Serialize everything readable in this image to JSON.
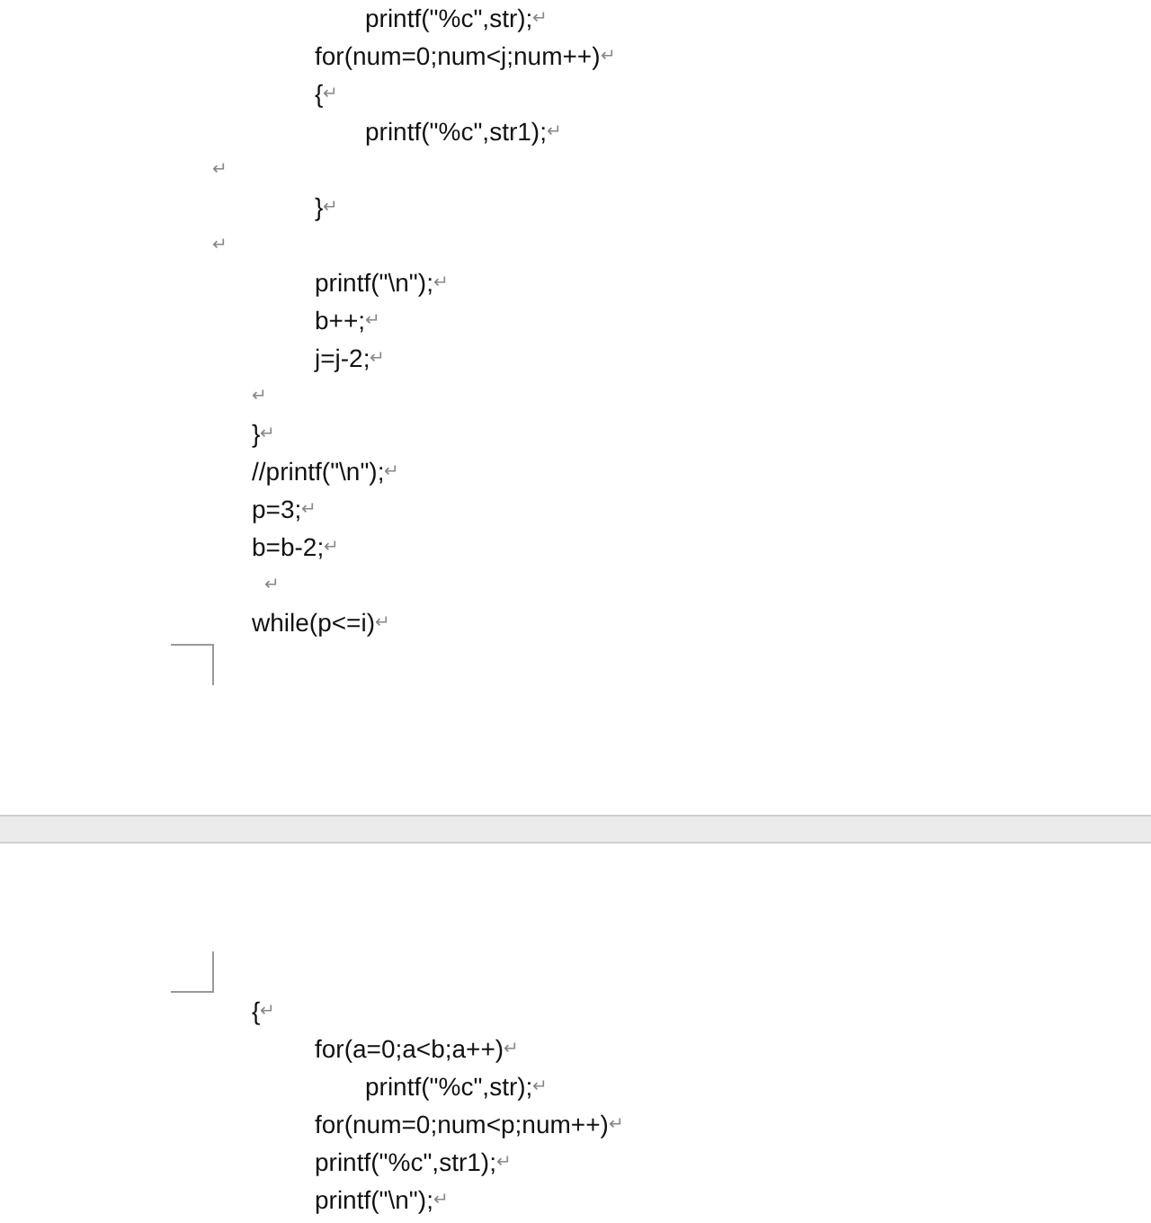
{
  "pages": [
    {
      "lines": [
        {
          "kind": "inner",
          "text": "printf(\"%c\",str);",
          "mark": "↵"
        },
        {
          "kind": "block",
          "text": "for(num=0;num<j;num++)",
          "mark": "↵"
        },
        {
          "kind": "block",
          "text": "{",
          "mark": "↵"
        },
        {
          "kind": "inner",
          "text": "printf(\"%c\",str1);",
          "mark": "↵"
        },
        {
          "kind": "margin",
          "mark": "↵"
        },
        {
          "kind": "block",
          "text": "}",
          "mark": "↵"
        },
        {
          "kind": "margin",
          "mark": "↵"
        },
        {
          "kind": "block",
          "text": "printf(\"\\n\");",
          "mark": "↵"
        },
        {
          "kind": "block",
          "text": "b++;",
          "mark": "↵"
        },
        {
          "kind": "block",
          "text": "j=j-2;",
          "mark": "↵"
        },
        {
          "kind": "body",
          "mark": "↵"
        },
        {
          "kind": "body",
          "text": "}",
          "mark": "↵"
        },
        {
          "kind": "body",
          "text": "//printf(\"\\n\");",
          "mark": "↵"
        },
        {
          "kind": "body",
          "text": "p=3;",
          "mark": "↵"
        },
        {
          "kind": "body",
          "text": "b=b-2;",
          "mark": "↵"
        },
        {
          "kind": "body_shift",
          "mark": "↵"
        },
        {
          "kind": "body",
          "text": "while(p<=i)",
          "mark": "↵"
        }
      ]
    },
    {
      "lines": [
        {
          "kind": "body",
          "text": "{",
          "mark": "↵"
        },
        {
          "kind": "block",
          "text": "for(a=0;a<b;a++)",
          "mark": "↵"
        },
        {
          "kind": "inner",
          "text": "printf(\"%c\",str);",
          "mark": "↵"
        },
        {
          "kind": "block",
          "text": "for(num=0;num<p;num++)",
          "mark": "↵"
        },
        {
          "kind": "block",
          "text": "printf(\"%c\",str1);",
          "mark": "↵"
        },
        {
          "kind": "block",
          "text": "printf(\"\\n\");",
          "mark": "↵"
        }
      ]
    }
  ]
}
